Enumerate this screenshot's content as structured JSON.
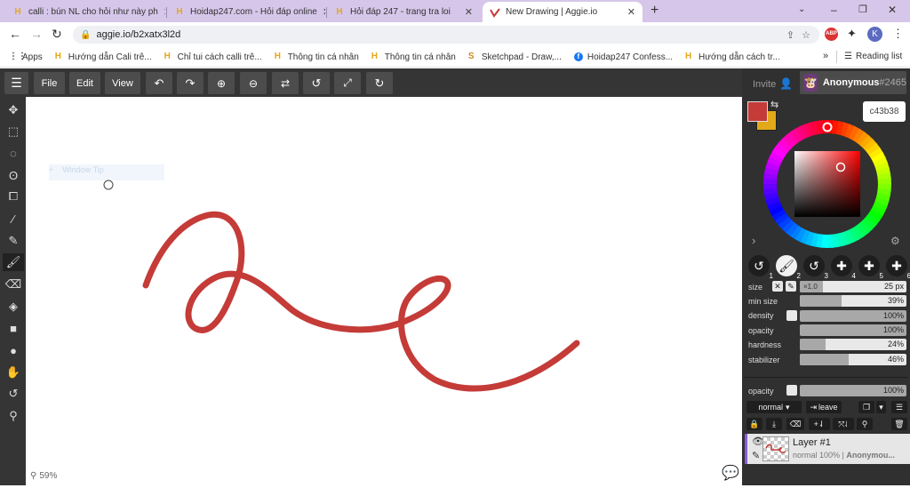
{
  "browser": {
    "tabs": [
      {
        "title": "calli : bún NL cho hỏi như này ph",
        "icon": "H"
      },
      {
        "title": "Hoidap247.com - Hỏi đáp online",
        "icon": "H"
      },
      {
        "title": "Hỏi đáp 247 - trang tra loi",
        "icon": "H"
      },
      {
        "title": "New Drawing | Aggie.io",
        "icon": "aggie-icon"
      }
    ],
    "new_tab": "+",
    "url": "aggie.io/b2xatx3l2d",
    "profile_initial": "K",
    "bookmarks": [
      {
        "label": "Apps"
      },
      {
        "label": "Hướng dẫn Cali trê..."
      },
      {
        "label": "Chỉ tui cách calli trê..."
      },
      {
        "label": "Thông tin cá nhân"
      },
      {
        "label": "Thông tin cá nhân"
      },
      {
        "label": "Sketchpad - Draw,..."
      },
      {
        "label": "Hoidap247 Confess..."
      },
      {
        "label": "Hướng dẫn cách tr..."
      }
    ],
    "more_bookmarks": "»",
    "reading_list": "Reading list"
  },
  "toolbar": {
    "file": "File",
    "edit": "Edit",
    "view": "View"
  },
  "user": {
    "invite": "Invite",
    "name": "Anonymous",
    "tag": "#2465"
  },
  "canvas": {
    "zoom": "59%",
    "window_tip": "Window Tip"
  },
  "color": {
    "primary": "#c43b38",
    "secondary": "#e2a91a",
    "hex_label": "c43b38"
  },
  "brush_slots": [
    "1",
    "2",
    "3",
    "4",
    "5",
    "6"
  ],
  "brush": {
    "size_label": "size",
    "size_mult": "×1.0",
    "size_value": "25 px",
    "rows": [
      {
        "label": "min size",
        "value": "39%",
        "pct": 39
      },
      {
        "label": "density",
        "value": "100%",
        "pct": 100
      },
      {
        "label": "opacity",
        "value": "100%",
        "pct": 100
      },
      {
        "label": "hardness",
        "value": "24%",
        "pct": 24
      },
      {
        "label": "stabilizer",
        "value": "46%",
        "pct": 46
      }
    ]
  },
  "layers": {
    "opacity_label": "opacity",
    "opacity_value": "100%",
    "blend": "normal",
    "leave": "leave",
    "layer_name": "Layer #1",
    "layer_meta": "normal 100% | ",
    "layer_owner": "Anonymou..."
  }
}
